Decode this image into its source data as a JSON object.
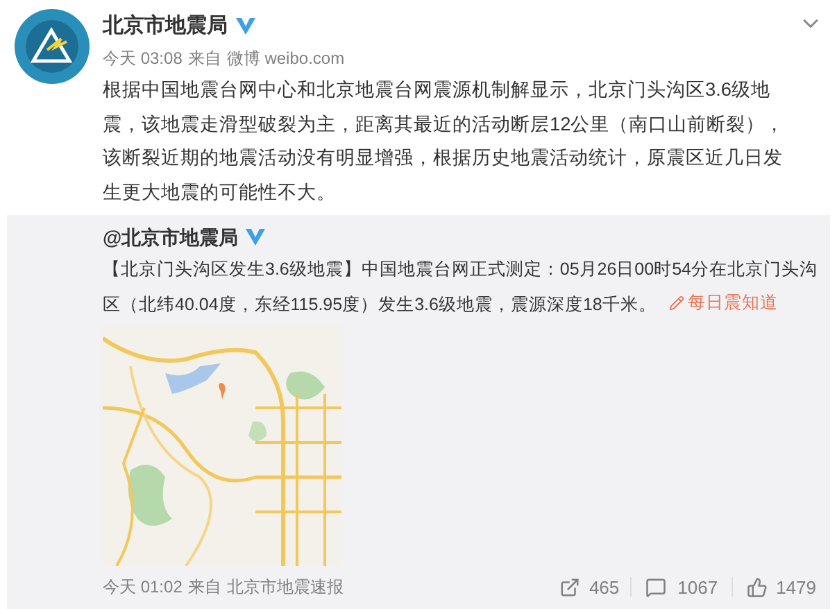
{
  "post": {
    "author": "北京市地震局",
    "verified": true,
    "time": "今天 03:08",
    "source_prefix": "来自",
    "source": "微博 weibo.com",
    "text": "根据中国地震台网中心和北京地震台网震源机制解显示，北京门头沟区3.6级地震，该地震走滑型破裂为主，距离其最近的活动断层12公里（南口山前断裂），该断裂近期的地震活动没有明显增强，根据历史地震活动统计，原震区近几日发生更大地震的可能性不大。"
  },
  "repost": {
    "author": "@北京市地震局",
    "verified": true,
    "text": "【北京门头沟区发生3.6级地震】中国地震台网正式测定：05月26日00时54分在北京门头沟区（北纬40.04度，东经115.95度）发生3.6级地震，震源深度18千米。",
    "link": "每日震知道",
    "time": "今天 01:02",
    "source_prefix": "来自",
    "source": "北京市地震速报",
    "shares": "465",
    "comments": "1067",
    "likes": "1479"
  }
}
